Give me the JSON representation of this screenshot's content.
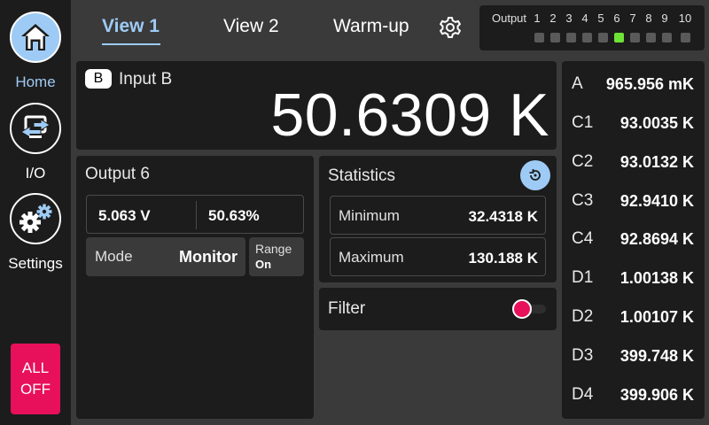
{
  "sidebar": {
    "items": [
      {
        "label": "Home",
        "icon": "home-icon",
        "active": true
      },
      {
        "label": "I/O",
        "icon": "io-icon",
        "active": false
      },
      {
        "label": "Settings",
        "icon": "settings-gears-icon",
        "active": false
      }
    ],
    "all_off": {
      "line1": "ALL",
      "line2": "OFF",
      "color": "#e8105a"
    }
  },
  "header": {
    "tabs": [
      {
        "label": "View 1",
        "active": true
      },
      {
        "label": "View 2",
        "active": false
      },
      {
        "label": "Warm-up",
        "active": false
      }
    ],
    "settings_icon": "gear-icon",
    "accent_color": "#9ecbf5"
  },
  "outputs": {
    "label": "Output",
    "numbers": [
      "1",
      "2",
      "3",
      "4",
      "5",
      "6",
      "7",
      "8",
      "9",
      "10"
    ],
    "active_index": 6,
    "active_color": "#6fe335"
  },
  "input": {
    "badge": "B",
    "title": "Input B",
    "value": "50.6309 K"
  },
  "output_panel": {
    "title": "Output 6",
    "voltage": "5.063 V",
    "percent": "50.63%",
    "mode_label": "Mode",
    "mode_value": "Monitor",
    "range_label": "Range",
    "range_value": "On"
  },
  "statistics": {
    "title": "Statistics",
    "reset_icon": "reset-icon",
    "min_label": "Minimum",
    "min_value": "32.4318 K",
    "max_label": "Maximum",
    "max_value": "130.188 K"
  },
  "filter": {
    "title": "Filter",
    "enabled": false
  },
  "channels": [
    {
      "name": "A",
      "value": "965.956 mK"
    },
    {
      "name": "C1",
      "value": "93.0035 K"
    },
    {
      "name": "C2",
      "value": "93.0132 K"
    },
    {
      "name": "C3",
      "value": "92.9410 K"
    },
    {
      "name": "C4",
      "value": "92.8694 K"
    },
    {
      "name": "D1",
      "value": "1.00138 K"
    },
    {
      "name": "D2",
      "value": "1.00107 K"
    },
    {
      "name": "D3",
      "value": "399.748 K"
    },
    {
      "name": "D4",
      "value": "399.906 K"
    }
  ]
}
